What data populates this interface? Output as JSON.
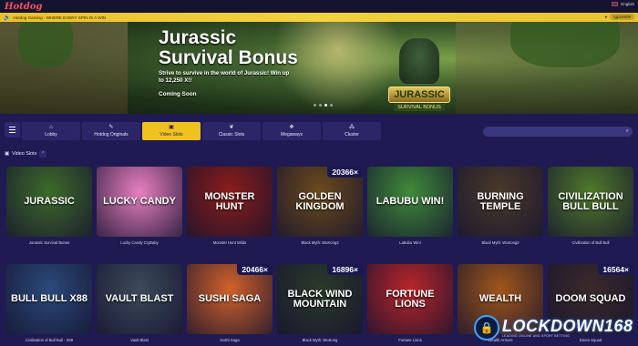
{
  "header": {
    "logo": "Hotdog",
    "language": "English"
  },
  "marquee": {
    "text": "Hotdog Gaming - WHERE EVERY SPIN IS A WIN",
    "username": "tgp24609"
  },
  "hero": {
    "title": "Jurassic Survival Bonus",
    "subtitle": "Strive to survive in the world of Jurassic! Win up to 12,250 X!!",
    "status": "Coming Soon",
    "game_logo_main": "JURASSIC",
    "game_logo_sub": "SURVIVAL BONUS",
    "slides": 4,
    "active_slide": 2
  },
  "nav": {
    "tabs": [
      {
        "label": "Lobby",
        "icon": "home-icon",
        "glyph": "⌂"
      },
      {
        "label": "Hotdog Originals",
        "icon": "tag-icon",
        "glyph": "✎"
      },
      {
        "label": "Video Slots",
        "icon": "slots-icon",
        "glyph": "▣"
      },
      {
        "label": "Classic Slots",
        "icon": "cherry-icon",
        "glyph": "❦"
      },
      {
        "label": "Megaways",
        "icon": "megaways-icon",
        "glyph": "❖"
      },
      {
        "label": "Cluster",
        "icon": "cluster-icon",
        "glyph": "⁂"
      }
    ],
    "active_tab": "Video Slots",
    "search_icon": "search-icon"
  },
  "section": {
    "title": "Video Slots"
  },
  "games": [
    {
      "caption": "Jurassic Survival Bonus",
      "art": "JURASSIC",
      "badge": "",
      "color": "#3d6a2a"
    },
    {
      "caption": "Lucky Candy CryBaby",
      "art": "LUCKY CANDY",
      "badge": "",
      "color": "#e87fc0"
    },
    {
      "caption": "Monster Hunt Wilds",
      "art": "MONSTER HUNT",
      "badge": "",
      "color": "#8a1d1a"
    },
    {
      "caption": "Black Myth: WuKong3",
      "art": "GOLDEN KINGDOM",
      "badge": "20366×",
      "color": "#6b4a1c"
    },
    {
      "caption": "Labubu Win!",
      "art": "LABUBU WIN!",
      "badge": "",
      "color": "#3f8a3a"
    },
    {
      "caption": "Black Myth: WuKong2",
      "art": "BURNING TEMPLE",
      "badge": "",
      "color": "#4a3a2a"
    },
    {
      "caption": "Civilization of Bull Bull",
      "art": "CIVILIZATION BULL BULL",
      "badge": "",
      "color": "#4f7a2a"
    },
    {
      "caption": "Civilization of Bull Bull - X88",
      "art": "BULL BULL X88",
      "badge": "",
      "color": "#2a4a7a"
    },
    {
      "caption": "Vault Blast",
      "art": "VAULT BLAST",
      "badge": "",
      "color": "#3b4a5a"
    },
    {
      "caption": "Sushi Saga",
      "art": "SUSHI SAGA",
      "badge": "20466×",
      "color": "#d2622a"
    },
    {
      "caption": "Black Myth: WuKong",
      "art": "BLACK WIND MOUNTAIN",
      "badge": "16896×",
      "color": "#2a3a2a"
    },
    {
      "caption": "Fortune Lions",
      "art": "FORTUNE LIONS",
      "badge": "",
      "color": "#b8262a"
    },
    {
      "caption": "Wealth Arrives",
      "art": "WEALTH",
      "badge": "",
      "color": "#a0561a"
    },
    {
      "caption": "Doom Squad",
      "art": "DOOM SQUAD",
      "badge": "16564×",
      "color": "#3a2a2a"
    }
  ],
  "watermark": {
    "word": "LOCKDOWN168",
    "tag": "LEADING ONLINE AND SPORT BETTING"
  }
}
